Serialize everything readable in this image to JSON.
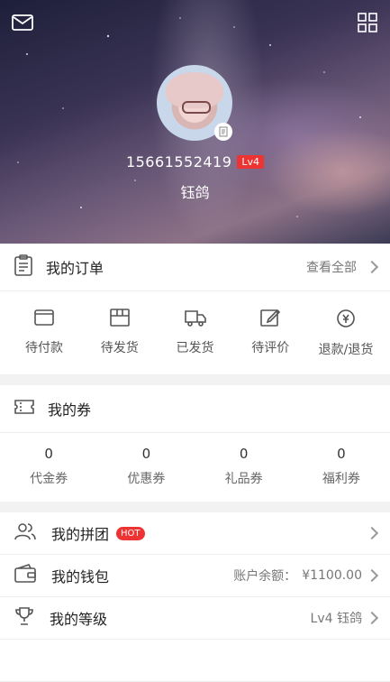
{
  "colors": {
    "accent": "#e53333",
    "header_dark": "#1e1f3a"
  },
  "header": {
    "phone": "15661552419",
    "level_badge": "Lv4",
    "nickname": "钰鸽"
  },
  "orders": {
    "title": "我的订单",
    "view_all": "查看全部",
    "items": [
      {
        "label": "待付款",
        "icon": "wallet-icon"
      },
      {
        "label": "待发货",
        "icon": "package-icon"
      },
      {
        "label": "已发货",
        "icon": "truck-icon"
      },
      {
        "label": "待评价",
        "icon": "edit-icon"
      },
      {
        "label": "退款/退货",
        "icon": "refund-icon"
      }
    ]
  },
  "coupons": {
    "title": "我的券",
    "items": [
      {
        "value": "0",
        "label": "代金券"
      },
      {
        "value": "0",
        "label": "优惠券"
      },
      {
        "value": "0",
        "label": "礼品券"
      },
      {
        "value": "0",
        "label": "福利券"
      }
    ]
  },
  "list": {
    "group_buy": {
      "title": "我的拼团",
      "badge": "HOT"
    },
    "wallet": {
      "title": "我的钱包",
      "balance_label": "账户余额：",
      "balance_value": "¥1100.00"
    },
    "level": {
      "title": "我的等级",
      "value": "Lv4 钰鸽"
    }
  }
}
